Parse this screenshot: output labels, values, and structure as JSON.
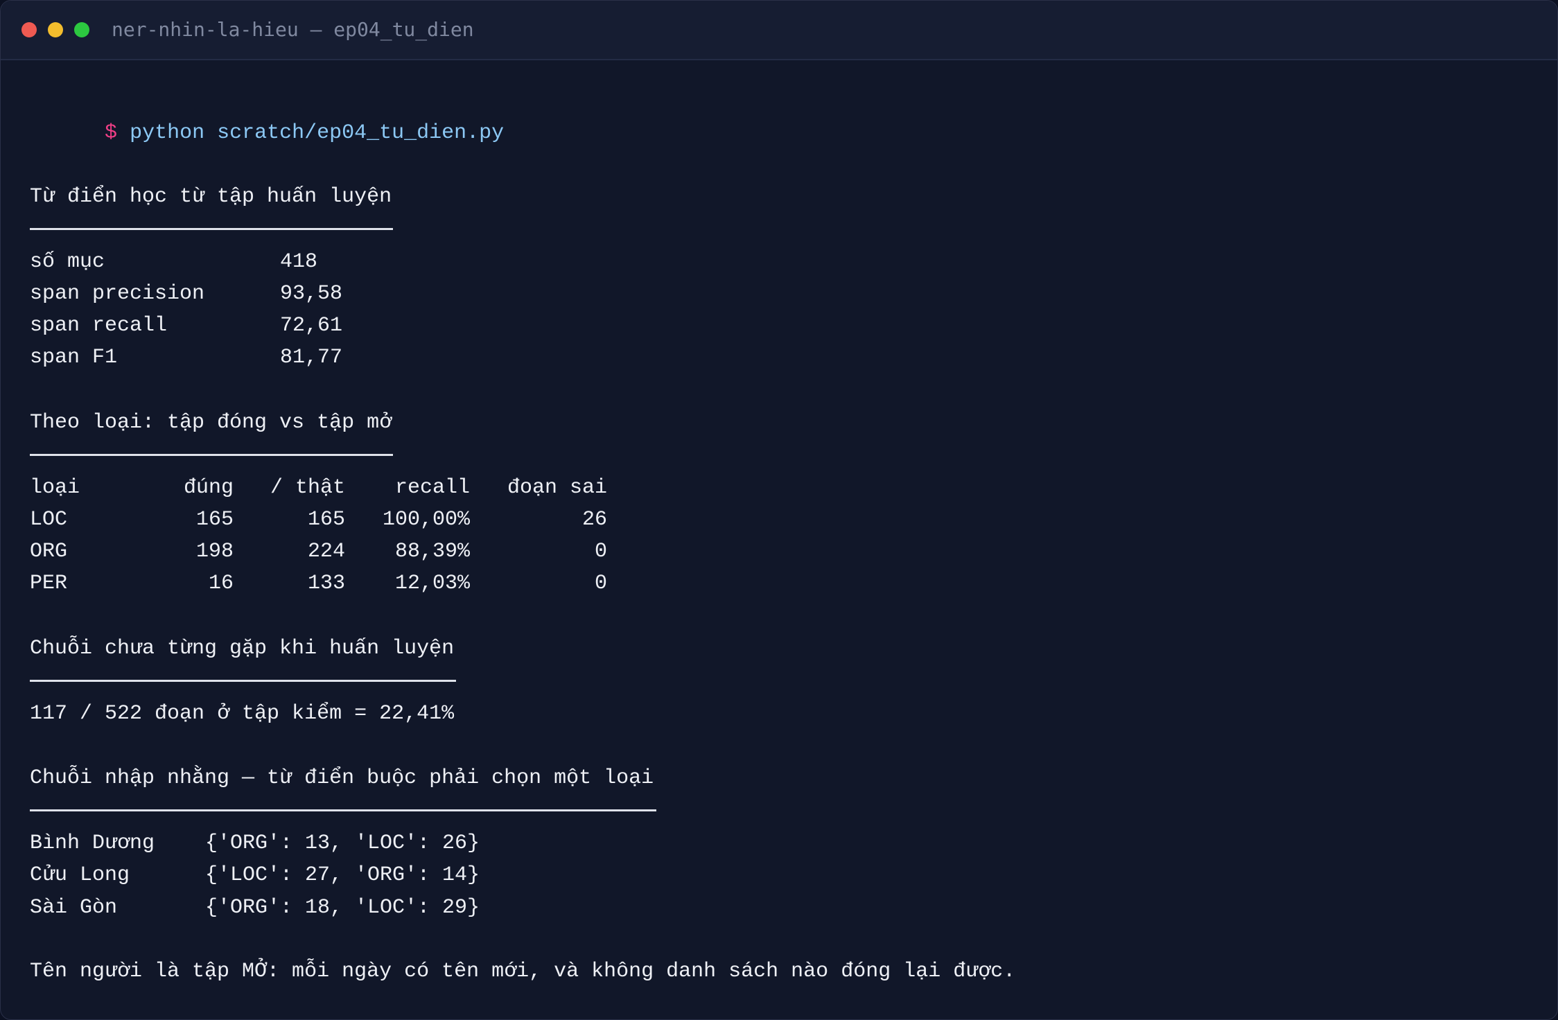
{
  "window": {
    "title": "ner-nhin-la-hieu — ep04_tu_dien"
  },
  "prompt": {
    "symbol": "$",
    "command": "python scratch/ep04_tu_dien.py"
  },
  "section1": {
    "heading": "Từ điển học từ tập huấn luyện",
    "rows": [
      {
        "label": "số mục",
        "value": "418"
      },
      {
        "label": "span precision",
        "value": "93,58"
      },
      {
        "label": "span recall",
        "value": "72,61"
      },
      {
        "label": "span F1",
        "value": "81,77"
      }
    ]
  },
  "section2": {
    "heading": "Theo loại: tập đóng vs tập mở",
    "columns": [
      "loại",
      "đúng",
      "/ thật",
      "recall",
      "đoạn sai"
    ],
    "rows": [
      {
        "type": "LOC",
        "correct": "165",
        "total": "165",
        "recall": "100,00%",
        "wrong": "26"
      },
      {
        "type": "ORG",
        "correct": "198",
        "total": "224",
        "recall": "88,39%",
        "wrong": "0"
      },
      {
        "type": "PER",
        "correct": "16",
        "total": "133",
        "recall": "12,03%",
        "wrong": "0"
      }
    ]
  },
  "section3": {
    "heading": "Chuỗi chưa từng gặp khi huấn luyện",
    "line": "117 / 522 đoạn ở tập kiểm = 22,41%"
  },
  "section4": {
    "heading": "Chuỗi nhập nhằng — từ điển buộc phải chọn một loại",
    "rows": [
      {
        "name": "Bình Dương",
        "counts": "{'ORG': 13, 'LOC': 26}"
      },
      {
        "name": "Cửu Long",
        "counts": "{'LOC': 27, 'ORG': 14}"
      },
      {
        "name": "Sài Gòn",
        "counts": "{'ORG': 18, 'LOC': 29}"
      }
    ]
  },
  "footer": {
    "line": "Tên người là tập MỞ: mỗi ngày có tên mới, và không danh sách nào đóng lại được."
  },
  "colors": {
    "background": "#111729",
    "titlebar": "#161d32",
    "text": "#eef0f5",
    "prompt": "#ef3f86",
    "command": "#8cc8f4",
    "close": "#ef5a52",
    "minimize": "#f3bd2d",
    "maximize": "#2cc840"
  }
}
